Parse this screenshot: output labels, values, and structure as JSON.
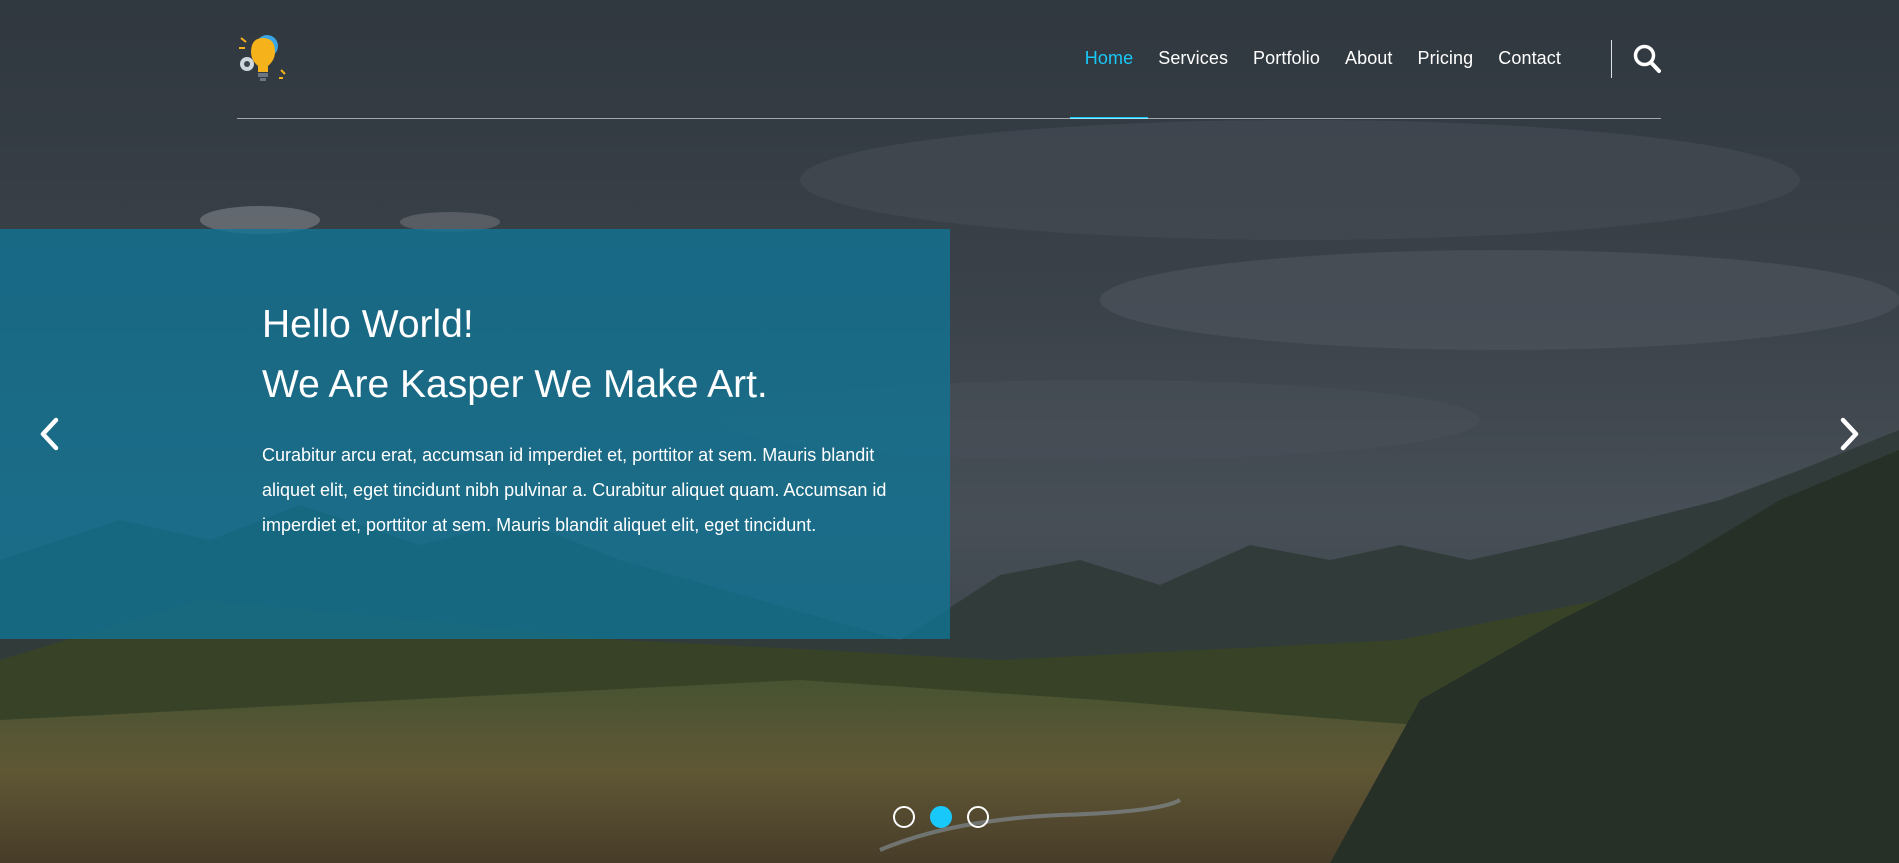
{
  "nav": {
    "items": [
      {
        "label": "Home",
        "active": true
      },
      {
        "label": "Services",
        "active": false
      },
      {
        "label": "Portfolio",
        "active": false
      },
      {
        "label": "About",
        "active": false
      },
      {
        "label": "Pricing",
        "active": false
      },
      {
        "label": "Contact",
        "active": false
      }
    ],
    "search_icon": "search-icon"
  },
  "logo": {
    "icon": "lightbulb-gears-icon"
  },
  "slider": {
    "title_line1": "Hello World!",
    "title_line2": "We Are Kasper We Make Art.",
    "description": "Curabitur arcu erat, accumsan id imperdiet et, porttitor at sem. Mauris blandit aliquet elit, eget tincidunt nibh pulvinar a. Curabitur aliquet quam. Accumsan id imperdiet et, porttitor at sem. Mauris blandit aliquet elit, eget tincidunt.",
    "prev_icon": "chevron-left-icon",
    "next_icon": "chevron-right-icon",
    "dot_count": 3,
    "active_dot": 1
  },
  "colors": {
    "accent": "#19c8fa",
    "panel": "#0f7496",
    "text": "#ffffff"
  }
}
